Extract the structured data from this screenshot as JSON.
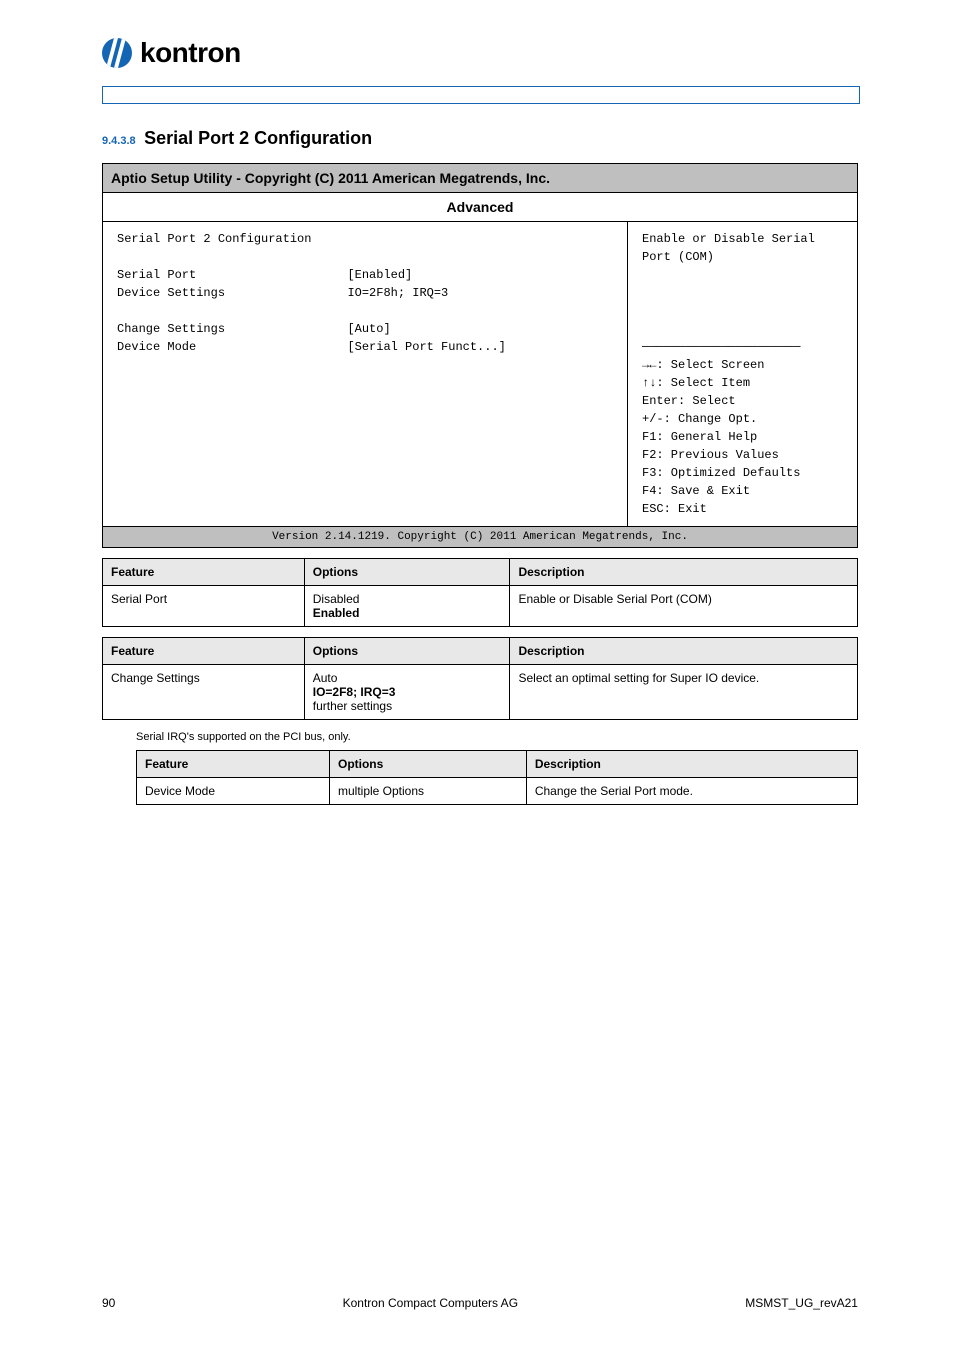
{
  "logo_text": "kontron",
  "section_number": "9.4.3.8",
  "section_title": "Serial Port 2 Configuration",
  "bios_header": "Aptio Setup Utility - Copyright (C) 2011 American Megatrends, Inc.",
  "bios_tab": "Advanced",
  "bios_left_lines": [
    "Serial Port 2 Configuration",
    "",
    "Serial Port                     [Enabled]",
    "Device Settings                 IO=2F8h; IRQ=3",
    "",
    "Change Settings                 [Auto]",
    "Device Mode                     [Serial Port Funct...]"
  ],
  "bios_right_lines": [
    "Enable or Disable Serial Port (COM)",
    "",
    "",
    "",
    "",
    "──────────────────────",
    "→←: Select Screen",
    "↑↓: Select Item",
    "Enter: Select",
    "+/-: Change Opt.",
    "F1: General Help",
    "F2: Previous Values",
    "F3: Optimized Defaults",
    "F4: Save & Exit",
    "ESC: Exit"
  ],
  "bios_footer": "Version 2.14.1219. Copyright (C) 2011 American Megatrends, Inc.",
  "tables": [
    {
      "headers": [
        "Feature",
        "Options",
        "Description"
      ],
      "rows": [
        {
          "feature": "Serial Port",
          "options_lines": [
            "Disabled",
            "Enabled"
          ],
          "description": "Enable or Disable Serial Port (COM)"
        }
      ]
    },
    {
      "headers": [
        "Feature",
        "Options",
        "Description"
      ],
      "rows": [
        {
          "feature": "Change Settings",
          "options_lines": [
            "Auto",
            "IO=2F8; IRQ=3",
            "further settings"
          ],
          "description": "Select an optimal setting for Super IO device."
        }
      ]
    }
  ],
  "sub_note": "Serial IRQ's supported on the PCI bus, only.",
  "sub_table": {
    "headers": [
      "Feature",
      "Options",
      "Description"
    ],
    "rows": [
      {
        "feature": "Device Mode",
        "options": "multiple Options",
        "description": "Change the Serial Port mode."
      }
    ]
  },
  "footer_left": "90",
  "footer_center": "Kontron Compact Computers AG",
  "footer_right": "MSMST_UG_revA21"
}
